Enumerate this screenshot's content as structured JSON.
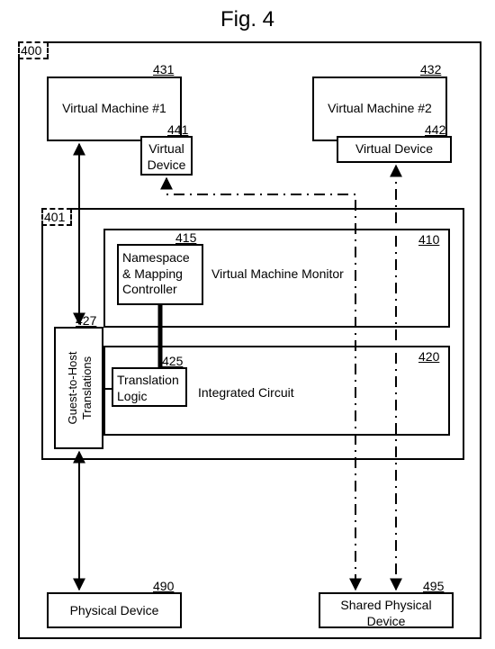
{
  "chart_data": {
    "type": "diagram",
    "title": "Fig. 4",
    "nodes": [
      {
        "id": "400",
        "label": "",
        "ref": "400",
        "kind": "system-boundary"
      },
      {
        "id": "431",
        "label": "Virtual Machine #1",
        "ref": "431"
      },
      {
        "id": "441",
        "label": "Virtual Device",
        "ref": "441",
        "parent": "431"
      },
      {
        "id": "432",
        "label": "Virtual Machine #2",
        "ref": "432"
      },
      {
        "id": "442",
        "label": "Virtual Device",
        "ref": "442",
        "parent": "432"
      },
      {
        "id": "401",
        "label": "",
        "ref": "401",
        "kind": "subsystem-boundary"
      },
      {
        "id": "410",
        "label": "Virtual Machine Monitor",
        "ref": "410",
        "parent": "401"
      },
      {
        "id": "415",
        "label": "Namespace & Mapping Controller",
        "ref": "415",
        "parent": "410"
      },
      {
        "id": "420",
        "label": "Integrated Circuit",
        "ref": "420",
        "parent": "401"
      },
      {
        "id": "425",
        "label": "Translation Logic",
        "ref": "425",
        "parent": "420"
      },
      {
        "id": "427",
        "label": "Guest-to-Host Translations",
        "ref": "427",
        "parent": "401"
      },
      {
        "id": "490",
        "label": "Physical Device",
        "ref": "490"
      },
      {
        "id": "495",
        "label": "Shared Physical Device",
        "ref": "495"
      }
    ],
    "edges": [
      {
        "from": "431",
        "to": "490",
        "via": "427",
        "style": "solid",
        "arrows": "both"
      },
      {
        "from": "415",
        "to": "425",
        "style": "solid-thick",
        "arrows": "none"
      },
      {
        "from": "427",
        "to": "425",
        "style": "solid",
        "arrows": "none"
      },
      {
        "from": "441",
        "to": "495",
        "via": "401",
        "style": "dash-dot",
        "arrows": "both"
      },
      {
        "from": "442",
        "to": "495",
        "style": "dash-dot",
        "arrows": "both"
      }
    ]
  },
  "title": "Fig. 4",
  "refs": {
    "r400": "400",
    "r431": "431",
    "r441": "441",
    "r432": "432",
    "r442": "442",
    "r401": "401",
    "r410": "410",
    "r415": "415",
    "r420": "420",
    "r425": "425",
    "r427": "427",
    "r490": "490",
    "r495": "495"
  },
  "labels": {
    "vm1": "Virtual Machine #1",
    "vm2": "Virtual Machine #2",
    "vd1": "Virtual\nDevice",
    "vd2": "Virtual Device",
    "vmm": "Virtual Machine Monitor",
    "nmc": "Namespace\n& Mapping\nController",
    "ic": "Integrated Circuit",
    "tl": "Translation\nLogic",
    "g2h": "Guest-to-Host\nTranslations",
    "pd": "Physical Device",
    "spd": "Shared Physical\nDevice"
  }
}
